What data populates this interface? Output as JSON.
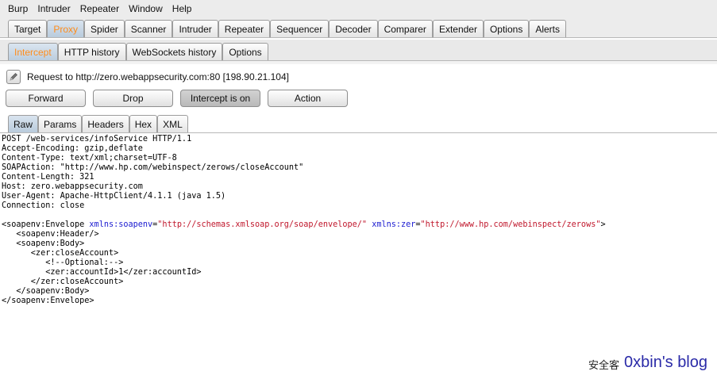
{
  "menu": [
    "Burp",
    "Intruder",
    "Repeater",
    "Window",
    "Help"
  ],
  "main_tabs": [
    "Target",
    "Proxy",
    "Spider",
    "Scanner",
    "Intruder",
    "Repeater",
    "Sequencer",
    "Decoder",
    "Comparer",
    "Extender",
    "Options",
    "Alerts"
  ],
  "active_main_tab": "Proxy",
  "proxy_tabs": [
    "Intercept",
    "HTTP history",
    "WebSockets history",
    "Options"
  ],
  "active_proxy_tab": "Intercept",
  "request": {
    "label": "Request to http://zero.webappsecurity.com:80  [198.90.21.104]"
  },
  "buttons": {
    "forward": "Forward",
    "drop": "Drop",
    "intercept": "Intercept is on",
    "action": "Action"
  },
  "view_tabs": [
    "Raw",
    "Params",
    "Headers",
    "Hex",
    "XML"
  ],
  "active_view_tab": "Raw",
  "headers": [
    "POST /web-services/infoService HTTP/1.1",
    "Accept-Encoding: gzip,deflate",
    "Content-Type: text/xml;charset=UTF-8",
    "SOAPAction: \"http://www.hp.com/webinspect/zerows/closeAccount\"",
    "Content-Length: 321",
    "Host: zero.webappsecurity.com",
    "User-Agent: Apache-HttpClient/4.1.1 (java 1.5)",
    "Connection: close"
  ],
  "body": {
    "env_open": "<soapenv:Envelope",
    "attr1": "xmlns:soapenv",
    "val1": "\"http://schemas.xmlsoap.org/soap/envelope/\"",
    "attr2": "xmlns:zer",
    "val2": "\"http://www.hp.com/webinspect/zerows\"",
    "env_close_bracket": ">",
    "lines": [
      "   <soapenv:Header/>",
      "   <soapenv:Body>",
      "      <zer:closeAccount>",
      "         <!--Optional:-->",
      "         <zer:accountId>1</zer:accountId>",
      "      </zer:closeAccount>",
      "   </soapenv:Body>",
      "</soapenv:Envelope>"
    ]
  },
  "watermark": {
    "cn": "安全客",
    "blog": "0xbin's blog"
  }
}
